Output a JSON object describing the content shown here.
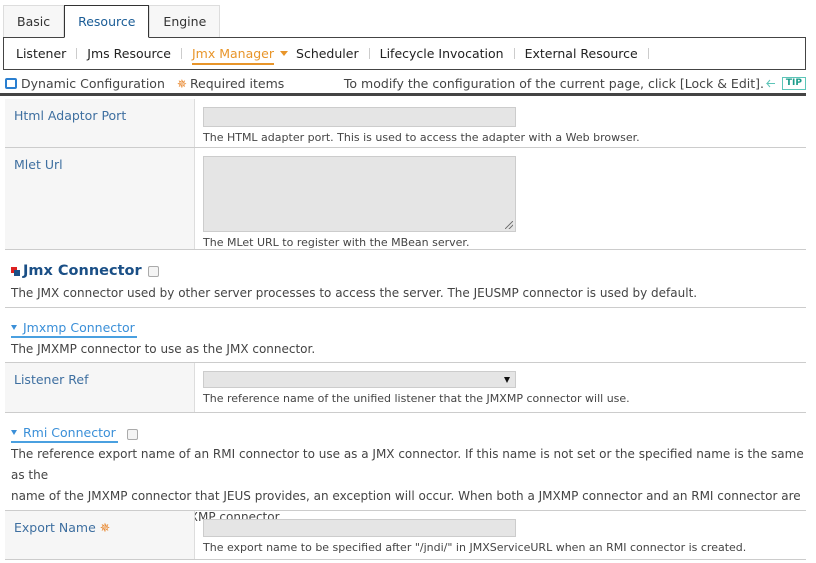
{
  "tabs": [
    {
      "label": "Basic",
      "active": false
    },
    {
      "label": "Resource",
      "active": true
    },
    {
      "label": "Engine",
      "active": false
    }
  ],
  "subnav": [
    {
      "label": "Listener",
      "active": false
    },
    {
      "label": "Jms Resource",
      "active": false
    },
    {
      "label": "Jmx Manager",
      "active": true
    },
    {
      "label": "Scheduler",
      "active": false
    },
    {
      "label": "Lifecycle Invocation",
      "active": false
    },
    {
      "label": "External Resource",
      "active": false
    }
  ],
  "infobar": {
    "dynamic_label": "Dynamic Configuration",
    "required_label": "Required items",
    "modify_text": "To modify the configuration of the current page, click [Lock & Edit].",
    "tip_label": "TIP"
  },
  "fields": {
    "html_adaptor_port": {
      "label": "Html Adaptor Port",
      "value": "",
      "description": "The HTML adapter port. This is used to access the adapter with a Web browser."
    },
    "mlet_url": {
      "label": "Mlet Url",
      "value": "",
      "description": "The MLet URL to register with the MBean server."
    },
    "listener_ref": {
      "label": "Listener Ref",
      "selected": "",
      "description": "The reference name of the unified listener that the JMXMP connector will use."
    },
    "export_name": {
      "label": "Export Name",
      "value": "",
      "required": true,
      "description": "The export name to be specified after \"/jndi/\" in JMXServiceURL when an RMI connector is created."
    }
  },
  "jmx_connector": {
    "title": "Jmx Connector",
    "checked": false,
    "description": "The JMX connector used by other server processes to access the server. The JEUSMP connector is used by default."
  },
  "jmxmp_connector": {
    "title": "Jmxmp Connector",
    "description": "The JMXMP connector to use as the JMX connector."
  },
  "rmi_connector": {
    "title": "Rmi Connector",
    "checked": false,
    "description_lines": [
      "The reference export name of an RMI connector to use as a JMX connector. If this name is not set or the specified name is the same as the",
      "name of the JMXMP connector that JEUS provides, an exception will occur. When both a JMXMP connector and an RMI connector are",
      "specified, JEUS will use the JMXMP connector."
    ]
  },
  "colors": {
    "accent_orange": "#e8952a",
    "label_blue": "#3e6fa0",
    "link_blue": "#3a8fd8",
    "tip_teal": "#1a9b8a"
  }
}
